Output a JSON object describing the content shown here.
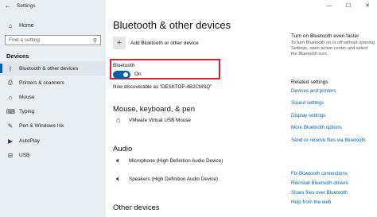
{
  "window": {
    "title": "Settings",
    "controls": [
      "—",
      "☐",
      "✕"
    ]
  },
  "sidebar": {
    "home_label": "Home",
    "search_placeholder": "Find a setting",
    "section_title": "Devices",
    "items": [
      {
        "label": "Bluetooth & other devices",
        "icon": "bluetooth-icon",
        "glyph": "ᛒ",
        "active": true
      },
      {
        "label": "Printers & scanners",
        "icon": "printer-icon",
        "glyph": "⎙"
      },
      {
        "label": "Mouse",
        "icon": "mouse-icon",
        "glyph": "⌂"
      },
      {
        "label": "Typing",
        "icon": "keyboard-icon",
        "glyph": "⌨"
      },
      {
        "label": "Pen & Windows Ink",
        "icon": "pen-icon",
        "glyph": "✎"
      },
      {
        "label": "AutoPlay",
        "icon": "autoplay-icon",
        "glyph": "▶"
      },
      {
        "label": "USB",
        "icon": "usb-icon",
        "glyph": "⊟"
      }
    ]
  },
  "main": {
    "title": "Bluetooth & other devices",
    "add_device_label": "Add Bluetooth or other device",
    "bluetooth_label": "Bluetooth",
    "toggle_state": "On",
    "discoverable_text": "Now discoverable as \"DESKTOP-4B2CMSQ\"",
    "sections": [
      {
        "title": "Mouse, keyboard, & pen",
        "devices": [
          {
            "name": "VMware Virtual USB Mouse",
            "icon": "mouse-icon"
          }
        ]
      },
      {
        "title": "Audio",
        "devices": [
          {
            "name": "Microphone (High Definition Audio Device)",
            "icon": "speaker-icon"
          },
          {
            "name": "Speakers (High Definition Audio Device)",
            "icon": "speaker-icon"
          }
        ]
      },
      {
        "title": "Other devices",
        "devices": []
      }
    ]
  },
  "right": {
    "fast_title": "Turn on Bluetooth even faster",
    "fast_desc": "To turn Bluetooth on or off without opening Settings, open action center and select the Bluetooth icon.",
    "related_title": "Related settings",
    "links": [
      "Devices and printers",
      "Sound settings",
      "Display settings",
      "More Bluetooth options",
      "Send or receive files via Bluetooth",
      "Fix Bluetooth connections",
      "Reinstall Bluetooth drivers",
      "Share files over Bluetooth",
      "Help from the web"
    ]
  },
  "colors": {
    "accent": "#0063b1",
    "highlight_border": "#d9232e",
    "sidebar_bg": "#e9eef2"
  }
}
